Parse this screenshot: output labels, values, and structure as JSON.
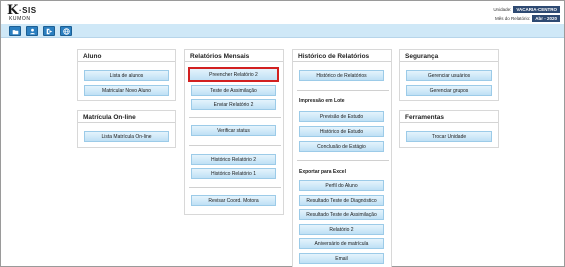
{
  "header": {
    "logo": "KSIS KUMON",
    "unit_label": "Unidade:",
    "unit_value": "VACARIA-CENTRO",
    "month_label": "Mês do Relatório:",
    "month_value": "Abr - 2020"
  },
  "toolbar": {
    "buttons": [
      "folder-icon",
      "user-icon",
      "logout-icon",
      "globe-icon"
    ]
  },
  "panels": {
    "aluno": {
      "title": "Aluno",
      "buttons": [
        "Lista de alunos",
        "Matricular Novo Aluno"
      ]
    },
    "matricula": {
      "title": "Matrícula On-line",
      "buttons": [
        "Lista Matrícula On-line"
      ]
    },
    "relatorios": {
      "title": "Relatórios Mensais",
      "buttons": [
        "Preencher Relatório 2",
        "Teste de Assimilação",
        "Enviar Relatório 2",
        "Verificar status",
        "Histórico Relatório 2",
        "Histórico Relatório 1",
        "Revisar Coord. Motora"
      ]
    },
    "historico": {
      "title": "Histórico de Relatórios",
      "buttons": [
        "Histórico de Relatórios"
      ],
      "lote_title": "Impressão em Lote",
      "lote_buttons": [
        "Previsão de Estudo",
        "Histórico de Estudo",
        "Conclusão de Estágio"
      ],
      "excel_title": "Exportar para Excel",
      "excel_buttons": [
        "Perfil do Aluno",
        "Resultado Teste de Diagnóstico",
        "Resultado Teste de Assimilação",
        "Relatório 2",
        "Aniversário de matrícula",
        "Email"
      ]
    },
    "seguranca": {
      "title": "Segurança",
      "buttons": [
        "Gerenciar usuários",
        "Gerenciar grupos"
      ]
    },
    "ferramentas": {
      "title": "Ferramentas",
      "buttons": [
        "Trocar Unidade"
      ]
    }
  },
  "colors": {
    "toolbar_bg": "#cfe8f7",
    "highlight": "#d22020",
    "header_badge": "#2e4a72"
  }
}
